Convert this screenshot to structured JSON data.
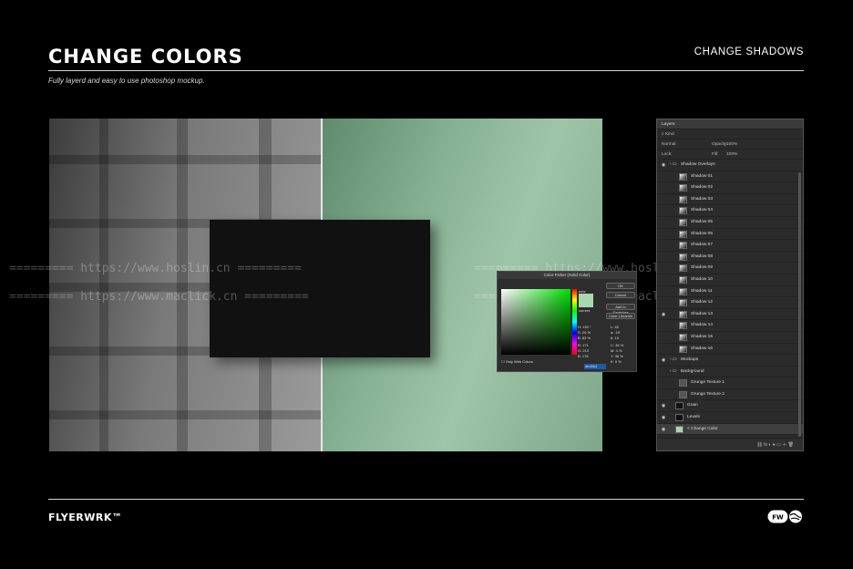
{
  "header": {
    "title": "CHANGE COLORS",
    "right_label": "CHANGE SHADOWS",
    "subtitle": "Fully layerd and easy to use photoshop mockup."
  },
  "watermarks": [
    "========= https://www.hoslin.cn =========",
    "========= https://www.maclick.cn ========="
  ],
  "color_picker": {
    "title": "Color Picker (Solid Color)",
    "new_label": "new",
    "current_label": "current",
    "buttons": [
      "OK",
      "Cancel",
      "Add to Swatches",
      "Color Libraries"
    ],
    "fields": [
      {
        "label": "H:",
        "value": "130",
        "unit": "°"
      },
      {
        "label": "S:",
        "value": "20",
        "unit": "%"
      },
      {
        "label": "B:",
        "value": "83",
        "unit": "%"
      },
      {
        "label": "R:",
        "value": "171"
      },
      {
        "label": "G:",
        "value": "213"
      },
      {
        "label": "B:",
        "value": "178"
      }
    ],
    "lab_fields": [
      {
        "label": "L:",
        "value": "82"
      },
      {
        "label": "a:",
        "value": "-19"
      },
      {
        "label": "b:",
        "value": "10"
      },
      {
        "label": "C:",
        "value": "36",
        "unit": "%"
      },
      {
        "label": "M:",
        "value": "4",
        "unit": "%"
      },
      {
        "label": "Y:",
        "value": "38",
        "unit": "%"
      },
      {
        "label": "K:",
        "value": "0",
        "unit": "%"
      }
    ],
    "hex": "abd5b2",
    "only_web": "Only Web Colors",
    "swatch_color": "#abd5b2"
  },
  "layers_panel": {
    "tab": "Layers",
    "filter": "Kind",
    "blend_mode": "Normal",
    "opacity_label": "Opacity:",
    "opacity": "100%",
    "lock_label": "Lock:",
    "fill_label": "Fill:",
    "fill": "100%",
    "layers": [
      {
        "name": "Shadow Overlays",
        "kind": "group",
        "visible": true
      },
      {
        "name": "Shadow 01",
        "kind": "shadow"
      },
      {
        "name": "Shadow 02",
        "kind": "shadow"
      },
      {
        "name": "Shadow 03",
        "kind": "shadow"
      },
      {
        "name": "Shadow 04",
        "kind": "shadow"
      },
      {
        "name": "Shadow 05",
        "kind": "shadow"
      },
      {
        "name": "Shadow 06",
        "kind": "shadow"
      },
      {
        "name": "Shadow 07",
        "kind": "shadow"
      },
      {
        "name": "Shadow 08",
        "kind": "shadow"
      },
      {
        "name": "Shadow 09",
        "kind": "shadow"
      },
      {
        "name": "Shadow 10",
        "kind": "shadow"
      },
      {
        "name": "Shadow 11",
        "kind": "shadow"
      },
      {
        "name": "Shadow 12",
        "kind": "shadow"
      },
      {
        "name": "Shadow 13",
        "kind": "shadow",
        "visible": true
      },
      {
        "name": "Shadow 14",
        "kind": "shadow"
      },
      {
        "name": "Shadow 15",
        "kind": "shadow"
      },
      {
        "name": "Shadow 16",
        "kind": "shadow"
      },
      {
        "name": "Mockups",
        "kind": "group",
        "visible": true
      },
      {
        "name": "Background",
        "kind": "group"
      },
      {
        "name": "Grunge Texture 1",
        "kind": "texture"
      },
      {
        "name": "Grunge Texture 2",
        "kind": "texture"
      },
      {
        "name": "Grain",
        "kind": "layer",
        "visible": true
      },
      {
        "name": "Levels",
        "kind": "adjust",
        "visible": true
      },
      {
        "name": "< Change Color",
        "kind": "color",
        "visible": true,
        "selected": true
      }
    ]
  },
  "footer": {
    "brand": "FLYERWRK™",
    "logo_text": "FW"
  },
  "colors": {
    "background": "#000000",
    "accent_green": "#87b293",
    "panel_bg": "#2b2b2b"
  }
}
